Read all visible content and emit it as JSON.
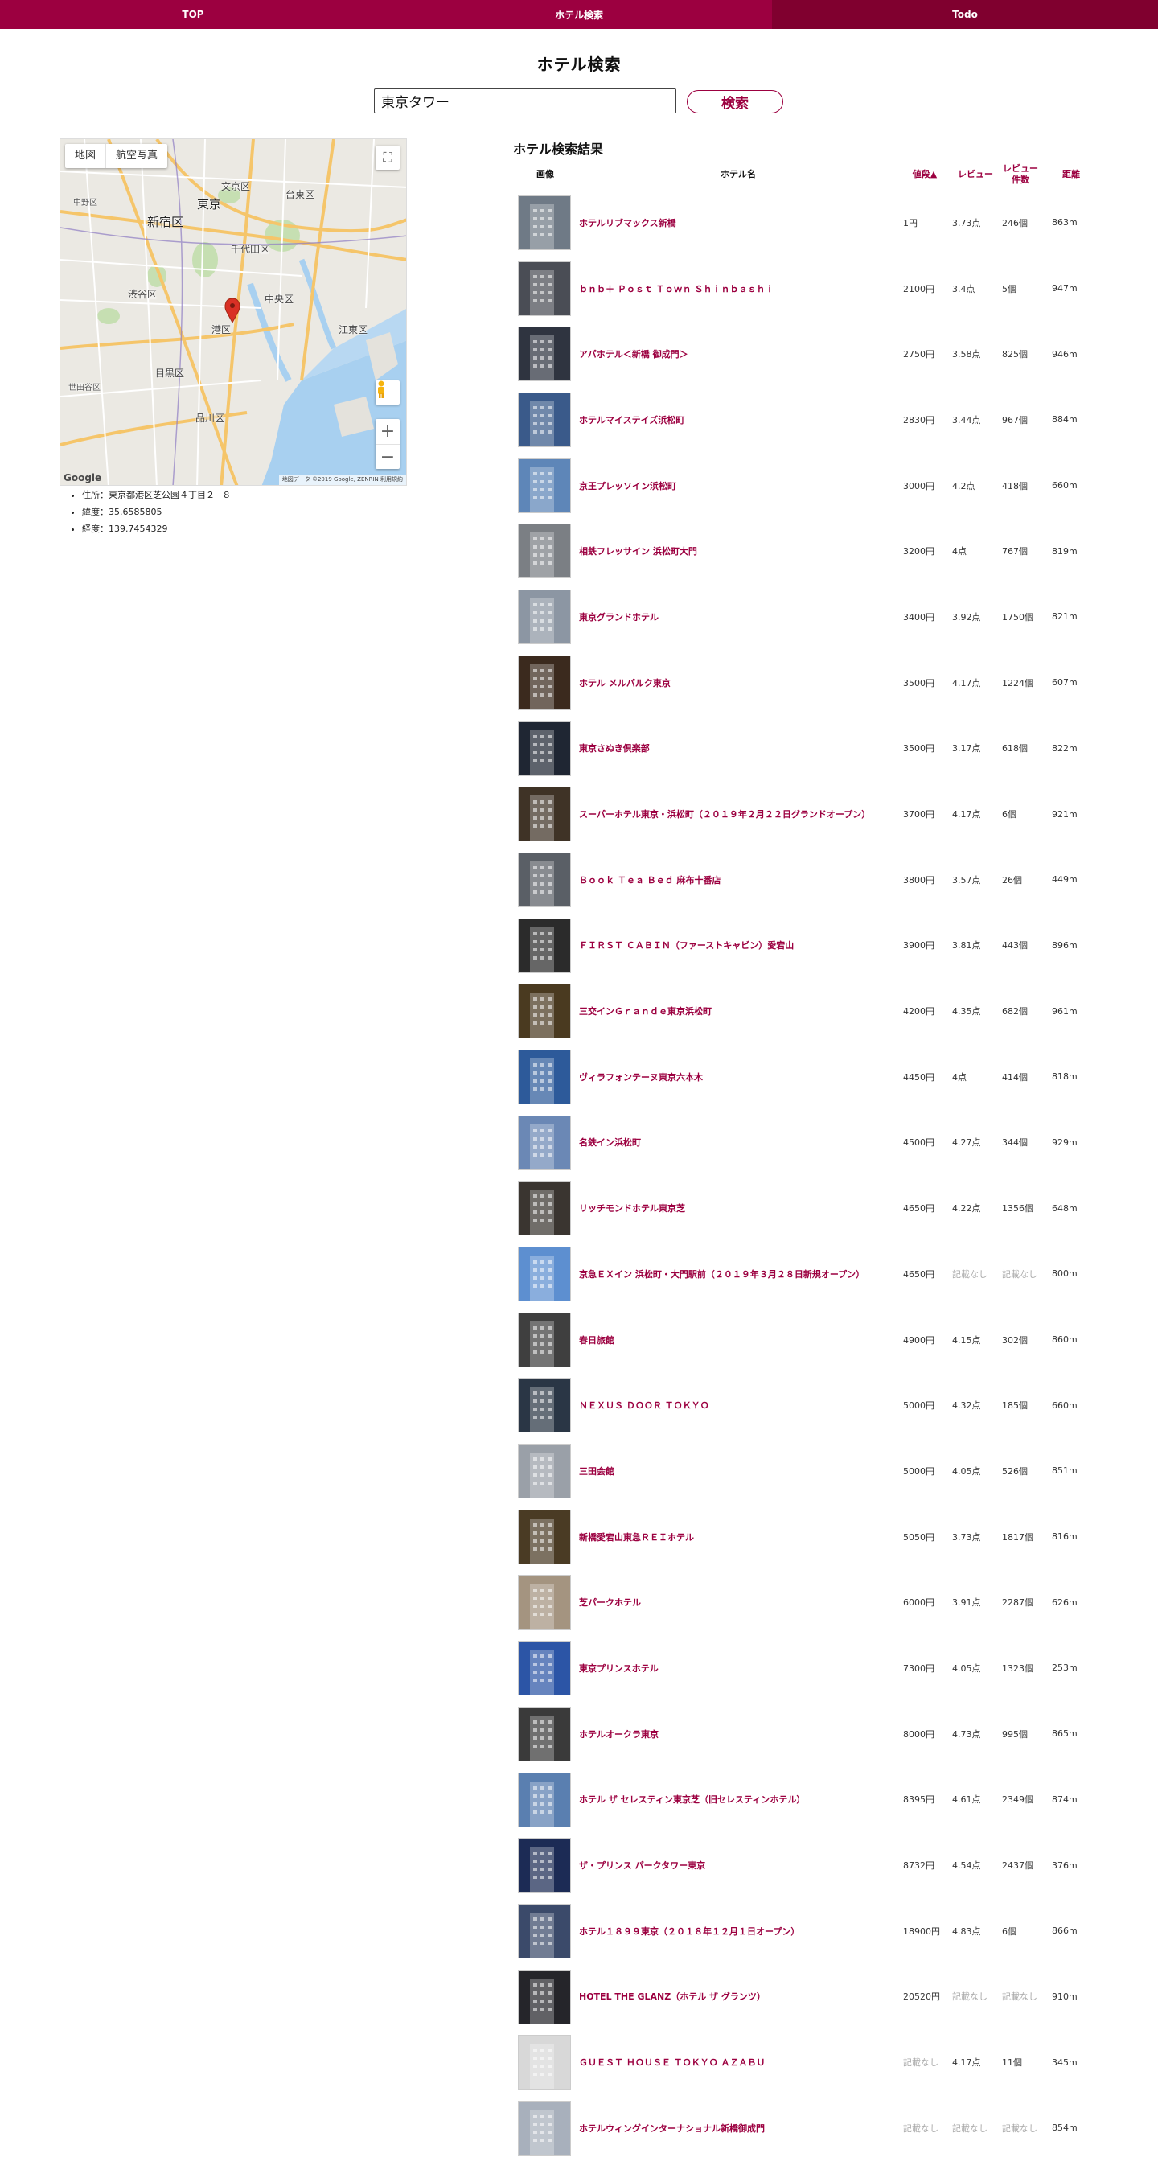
{
  "nav": {
    "tabs": [
      {
        "label": "TOP"
      },
      {
        "label": "ホテル検索"
      },
      {
        "label": "Todo"
      }
    ]
  },
  "page": {
    "title": "ホテル検索"
  },
  "search": {
    "value": "東京タワー",
    "button_label": "検索"
  },
  "map": {
    "type_buttons": [
      "地図",
      "航空写真"
    ],
    "labels": [
      "中野区",
      "文京区",
      "台東区",
      "新宿区",
      "東京",
      "千代田区",
      "渋谷区",
      "中央区",
      "港区",
      "江東区",
      "目黒区",
      "品川区",
      "世田谷区"
    ],
    "attribution": "地図データ ©2019 Google, ZENRIN 利用規約",
    "logo": "Google",
    "zoom_in": "+",
    "zoom_out": "−"
  },
  "info": {
    "address": "住所：東京都港区芝公園４丁目２−８",
    "latitude": "緯度：35.6585805",
    "longitude": "経度：139.7454329"
  },
  "results": {
    "title": "ホテル検索結果",
    "headers": {
      "image": "画像",
      "name": "ホテル名",
      "price": "値段▲",
      "review": "レビュー",
      "review_count": "レビュー件数",
      "distance": "距離"
    },
    "rows": [
      {
        "name": "ホテルリブマックス新橋",
        "price": "1円",
        "review": "3.73点",
        "count": "246個",
        "distance": "863m",
        "thumb": "#6f7a86"
      },
      {
        "name": "ｂｎｂ＋ Ｐｏｓｔ Ｔｏｗｎ Ｓｈｉｎｂａｓｈｉ",
        "price": "2100円",
        "review": "3.4点",
        "count": "5個",
        "distance": "947m",
        "thumb": "#4a4d55"
      },
      {
        "name": "アパホテル＜新橋 御成門＞",
        "price": "2750円",
        "review": "3.58点",
        "count": "825個",
        "distance": "946m",
        "thumb": "#2f3440"
      },
      {
        "name": "ホテルマイステイズ浜松町",
        "price": "2830円",
        "review": "3.44点",
        "count": "967個",
        "distance": "884m",
        "thumb": "#3a5a8a"
      },
      {
        "name": "京王プレッソイン浜松町",
        "price": "3000円",
        "review": "4.2点",
        "count": "418個",
        "distance": "660m",
        "thumb": "#5e86b8"
      },
      {
        "name": "相鉄フレッサイン 浜松町大門",
        "price": "3200円",
        "review": "4点",
        "count": "767個",
        "distance": "819m",
        "thumb": "#7b7f84"
      },
      {
        "name": "東京グランドホテル",
        "price": "3400円",
        "review": "3.92点",
        "count": "1750個",
        "distance": "821m",
        "thumb": "#8c96a3"
      },
      {
        "name": "ホテル メルパルク東京",
        "price": "3500円",
        "review": "4.17点",
        "count": "1224個",
        "distance": "607m",
        "thumb": "#3b2a1e"
      },
      {
        "name": "東京さぬき倶楽部",
        "price": "3500円",
        "review": "3.17点",
        "count": "618個",
        "distance": "822m",
        "thumb": "#1f2633"
      },
      {
        "name": "スーパーホテル東京・浜松町（２０１９年２月２２日グランドオープン）",
        "price": "3700円",
        "review": "4.17点",
        "count": "6個",
        "distance": "921m",
        "thumb": "#3f3326"
      },
      {
        "name": "Ｂｏｏｋ Ｔｅａ Ｂｅｄ 麻布十番店",
        "price": "3800円",
        "review": "3.57点",
        "count": "26個",
        "distance": "449m",
        "thumb": "#5a5f66"
      },
      {
        "name": "ＦＩＲＳＴ ＣＡＢＩＮ（ファーストキャビン）愛宕山",
        "price": "3900円",
        "review": "3.81点",
        "count": "443個",
        "distance": "896m",
        "thumb": "#2b2b2b"
      },
      {
        "name": "三交インＧｒａｎｄｅ東京浜松町",
        "price": "4200円",
        "review": "4.35点",
        "count": "682個",
        "distance": "961m",
        "thumb": "#4a3a20"
      },
      {
        "name": "ヴィラフォンテーヌ東京六本木",
        "price": "4450円",
        "review": "4点",
        "count": "414個",
        "distance": "818m",
        "thumb": "#2d5a9a"
      },
      {
        "name": "名鉄イン浜松町",
        "price": "4500円",
        "review": "4.27点",
        "count": "344個",
        "distance": "929m",
        "thumb": "#6b88b5"
      },
      {
        "name": "リッチモンドホテル東京芝",
        "price": "4650円",
        "review": "4.22点",
        "count": "1356個",
        "distance": "648m",
        "thumb": "#3a3530"
      },
      {
        "name": "京急ＥＸイン 浜松町・大門駅前（２０１９年３月２８日新規オープン）",
        "price": "4650円",
        "review": "記載なし",
        "count": "記載なし",
        "distance": "800m",
        "thumb": "#5d8fd0"
      },
      {
        "name": "春日旅館",
        "price": "4900円",
        "review": "4.15点",
        "count": "302個",
        "distance": "860m",
        "thumb": "#3f3f3f"
      },
      {
        "name": "ＮＥＸＵＳ ＤＯＯＲ ＴＯＫＹＯ",
        "price": "5000円",
        "review": "4.32点",
        "count": "185個",
        "distance": "660m",
        "thumb": "#2a3645"
      },
      {
        "name": "三田会館",
        "price": "5000円",
        "review": "4.05点",
        "count": "526個",
        "distance": "851m",
        "thumb": "#9aa0a8"
      },
      {
        "name": "新橋愛宕山東急ＲＥＩホテル",
        "price": "5050円",
        "review": "3.73点",
        "count": "1817個",
        "distance": "816m",
        "thumb": "#4a3b24"
      },
      {
        "name": "芝パークホテル",
        "price": "6000円",
        "review": "3.91点",
        "count": "2287個",
        "distance": "626m",
        "thumb": "#a49480"
      },
      {
        "name": "東京プリンスホテル",
        "price": "7300円",
        "review": "4.05点",
        "count": "1323個",
        "distance": "253m",
        "thumb": "#2c55a6"
      },
      {
        "name": "ホテルオークラ東京",
        "price": "8000円",
        "review": "4.73点",
        "count": "995個",
        "distance": "865m",
        "thumb": "#3a3a3a"
      },
      {
        "name": "ホテル ザ セレスティン東京芝（旧セレスティンホテル）",
        "price": "8395円",
        "review": "4.61点",
        "count": "2349個",
        "distance": "874m",
        "thumb": "#5a7fb0"
      },
      {
        "name": "ザ・プリンス パークタワー東京",
        "price": "8732円",
        "review": "4.54点",
        "count": "2437個",
        "distance": "376m",
        "thumb": "#1c2b55"
      },
      {
        "name": "ホテル１８９９東京（２０１８年１２月１日オープン）",
        "price": "18900円",
        "review": "4.83点",
        "count": "6個",
        "distance": "866m",
        "thumb": "#3b4a6a"
      },
      {
        "name": "HOTEL THE GLANZ（ホテル ザ グランツ）",
        "price": "20520円",
        "review": "記載なし",
        "count": "記載なし",
        "distance": "910m",
        "thumb": "#25252a"
      },
      {
        "name": "ＧＵＥＳＴ ＨＯＵＳＥ ＴＯＫＹＯ ＡＺＡＢＵ",
        "price": "記載なし",
        "review": "4.17点",
        "count": "11個",
        "distance": "345m",
        "thumb": "#d8d8d8"
      },
      {
        "name": "ホテルウィングインターナショナル新橋御成門",
        "price": "記載なし",
        "review": "記載なし",
        "count": "記載なし",
        "distance": "854m",
        "thumb": "#a8b0bc"
      }
    ]
  },
  "colors": {
    "accent": "#9c0040",
    "nav_dark": "#80002f",
    "na_text": "#aaaaaa"
  }
}
